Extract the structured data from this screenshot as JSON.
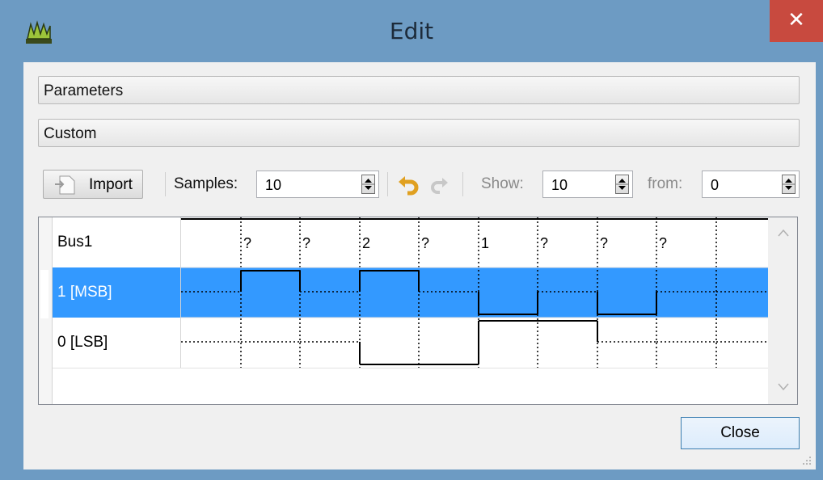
{
  "window": {
    "title": "Edit",
    "close_glyph": "✕"
  },
  "sections": {
    "parameters": "Parameters",
    "custom": "Custom"
  },
  "toolbar": {
    "import_label": "Import",
    "samples_label": "Samples:",
    "samples_value": "10",
    "show_label": "Show:",
    "show_value": "10",
    "from_label": "from:",
    "from_value": "0",
    "undo_icon": "undo-icon",
    "redo_icon": "redo-icon"
  },
  "signals": {
    "rows": [
      {
        "label": "Bus1",
        "type": "bus",
        "values": [
          "?",
          "?",
          "2",
          "?",
          "1",
          "?",
          "?",
          "?"
        ]
      },
      {
        "label": "1 [MSB]",
        "type": "bit",
        "selected": true,
        "levels": [
          "Z",
          "1",
          "Z",
          "1",
          "Z",
          "0",
          "Z",
          "0",
          "Z",
          "Z"
        ]
      },
      {
        "label": "0 [LSB]",
        "type": "bit",
        "selected": false,
        "levels": [
          "Z",
          "Z",
          "Z",
          "0",
          "0",
          "1",
          "1",
          "Z",
          "Z",
          "Z"
        ]
      }
    ]
  },
  "footer": {
    "close_label": "Close"
  },
  "colors": {
    "selection": "#3399ff",
    "titlebar": "#6d9bc3",
    "close": "#c84a3f"
  }
}
